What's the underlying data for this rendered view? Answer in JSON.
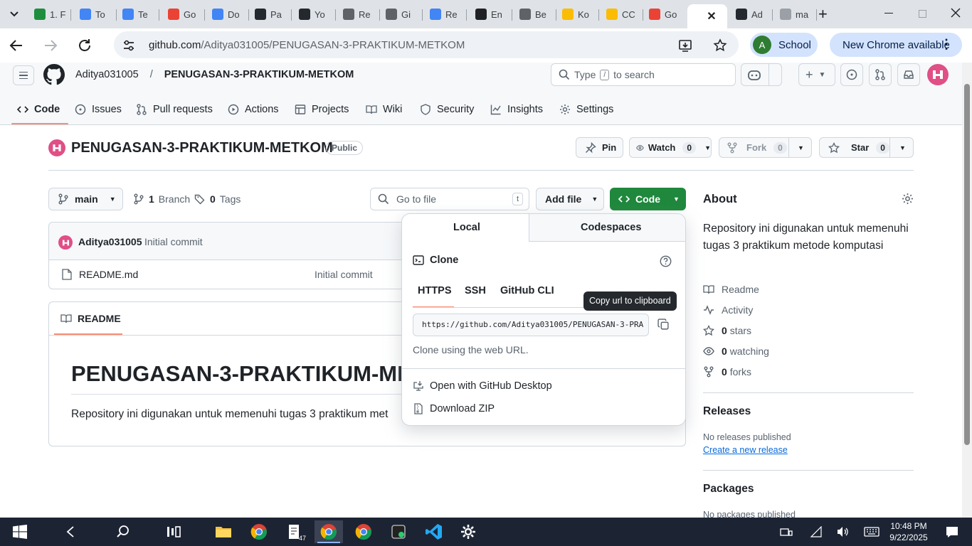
{
  "browser": {
    "tabs": [
      "1. F",
      "To",
      "Te",
      "Go",
      "Do",
      "Pa",
      "Yo",
      "Re",
      "Gi",
      "Re",
      "En",
      "Be",
      "Ko",
      "CC",
      "Go",
      "",
      "Ad",
      "ma"
    ],
    "url_host": "github.com",
    "url_path": "/Aditya031005/PENUGASAN-3-PRAKTIKUM-METKOM",
    "profile_letter": "A",
    "profile_name": "School",
    "update_label": "New Chrome available"
  },
  "header": {
    "owner": "Aditya031005",
    "slash": "/",
    "repo": "PENUGASAN-3-PRAKTIKUM-METKOM",
    "search_prefix": "Type",
    "search_key": "/",
    "search_suffix": "to search"
  },
  "nav": {
    "code": "Code",
    "issues": "Issues",
    "pulls": "Pull requests",
    "actions": "Actions",
    "projects": "Projects",
    "wiki": "Wiki",
    "security": "Security",
    "insights": "Insights",
    "settings": "Settings"
  },
  "repo": {
    "title": "PENUGASAN-3-PRAKTIKUM-METKOM",
    "visibility": "Public",
    "pin": "Pin",
    "watch": "Watch",
    "watch_count": "0",
    "fork": "Fork",
    "fork_count": "0",
    "star": "Star",
    "star_count": "0"
  },
  "filebar": {
    "branch": "main",
    "branch_count": "1",
    "branch_label": "Branch",
    "tag_count": "0",
    "tag_label": "Tags",
    "goto_placeholder": "Go to file",
    "goto_key": "t",
    "add_file": "Add file",
    "code_button": "Code"
  },
  "commit": {
    "author": "Aditya031005",
    "message": "Initial commit"
  },
  "files": [
    {
      "name": "README.md",
      "commit": "Initial commit"
    }
  ],
  "readme": {
    "tab": "README",
    "heading": "PENUGASAN-3-PRAKTIKUM-ME",
    "body": "Repository ini digunakan untuk memenuhi tugas 3 praktikum met"
  },
  "dropdown": {
    "tab_local": "Local",
    "tab_codespaces": "Codespaces",
    "clone": "Clone",
    "https": "HTTPS",
    "ssh": "SSH",
    "cli": "GitHub CLI",
    "clone_url": "https://github.com/Aditya031005/PENUGASAN-3-PRA",
    "hint": "Clone using the web URL.",
    "tooltip": "Copy url to clipboard",
    "open_desktop": "Open with GitHub Desktop",
    "download_zip": "Download ZIP"
  },
  "about": {
    "title": "About",
    "description": "Repository ini digunakan untuk memenuhi tugas 3 praktikum metode komputasi",
    "readme": "Readme",
    "activity": "Activity",
    "stars_count": "0",
    "stars_label": "stars",
    "watching_count": "0",
    "watching_label": "watching",
    "forks_count": "0",
    "forks_label": "forks",
    "releases_title": "Releases",
    "no_releases": "No releases published",
    "create_release": "Create a new release",
    "packages_title": "Packages",
    "no_packages": "No packages published"
  },
  "taskbar": {
    "time": "10:48 PM",
    "date": "9/22/2025",
    "badge": "47"
  },
  "colors": {
    "accent": "#1f883d",
    "link": "#0969da",
    "underline": "#fd8c73",
    "taskbar": "#1c2434"
  }
}
